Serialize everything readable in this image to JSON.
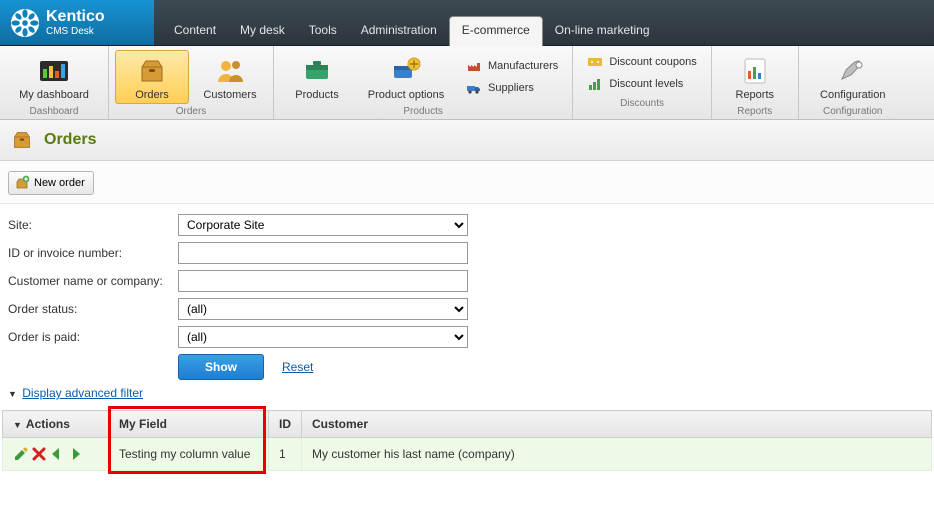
{
  "brand": {
    "name": "Kentico",
    "sub": "CMS Desk"
  },
  "topnav": {
    "items": [
      {
        "label": "Content"
      },
      {
        "label": "My desk"
      },
      {
        "label": "Tools"
      },
      {
        "label": "Administration"
      },
      {
        "label": "E-commerce",
        "active": true
      },
      {
        "label": "On-line marketing"
      }
    ]
  },
  "ribbon": {
    "groups": {
      "dashboard": {
        "label": "Dashboard",
        "items": [
          {
            "label": "My dashboard"
          }
        ]
      },
      "orders": {
        "label": "Orders",
        "items": [
          {
            "label": "Orders",
            "selected": true
          },
          {
            "label": "Customers"
          }
        ]
      },
      "products": {
        "label": "Products",
        "big": [
          {
            "label": "Products"
          },
          {
            "label": "Product options"
          }
        ],
        "small": [
          {
            "label": "Manufacturers"
          },
          {
            "label": "Suppliers"
          }
        ]
      },
      "discounts": {
        "label": "Discounts",
        "small": [
          {
            "label": "Discount coupons"
          },
          {
            "label": "Discount levels"
          }
        ]
      },
      "reports": {
        "label": "Reports",
        "items": [
          {
            "label": "Reports"
          }
        ]
      },
      "config": {
        "label": "Configuration",
        "items": [
          {
            "label": "Configuration"
          }
        ]
      }
    }
  },
  "page": {
    "title": "Orders"
  },
  "toolbar": {
    "new_order": "New order"
  },
  "filter": {
    "labels": {
      "site": "Site:",
      "id": "ID or invoice number:",
      "customer": "Customer name or company:",
      "status": "Order status:",
      "paid": "Order is paid:"
    },
    "values": {
      "site": "Corporate Site",
      "id": "",
      "customer": "",
      "status": "(all)",
      "paid": "(all)"
    },
    "show": "Show",
    "reset": "Reset",
    "adv": "Display advanced filter"
  },
  "grid": {
    "headers": {
      "actions": "Actions",
      "myfield": "My Field",
      "id": "ID",
      "customer": "Customer"
    },
    "rows": [
      {
        "myfield": "Testing my column value",
        "id": "1",
        "customer": "My customer his last name (company)"
      }
    ]
  }
}
